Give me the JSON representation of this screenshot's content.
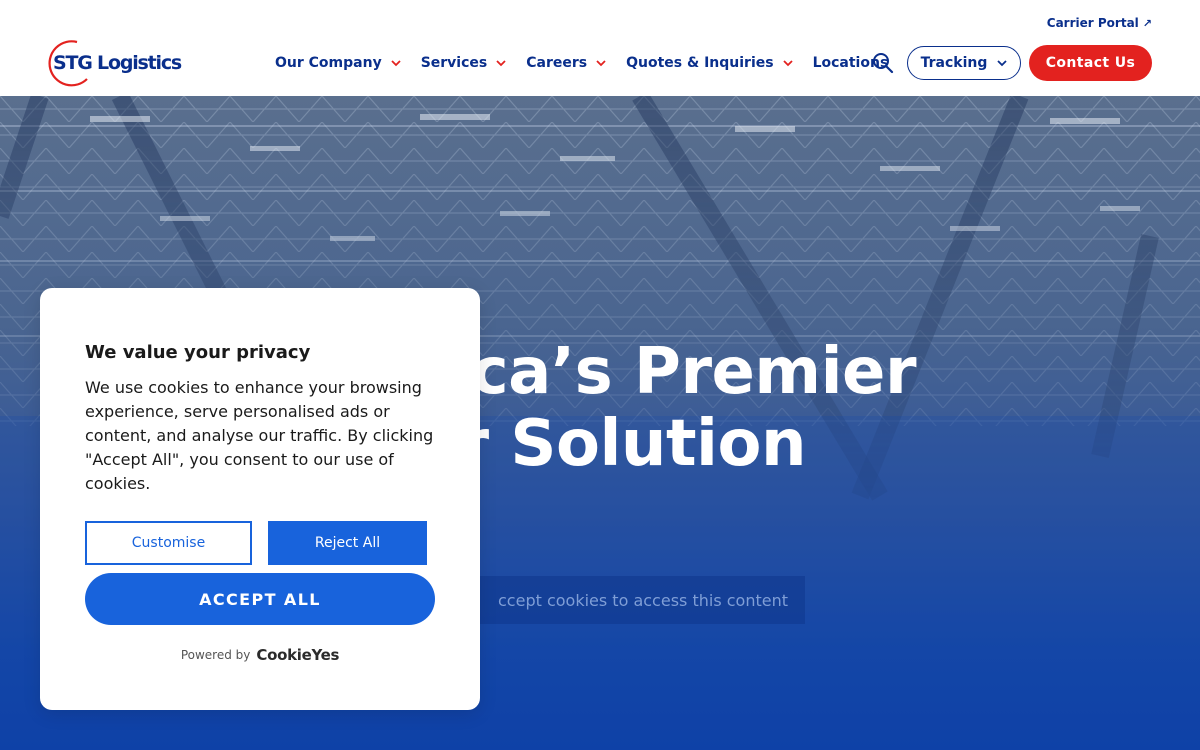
{
  "header": {
    "logo_text": "STG Logistics",
    "carrier_portal_label": "Carrier Portal",
    "carrier_portal_icon": "external-arrow-icon",
    "nav": [
      {
        "label": "Our Company",
        "has_dropdown": true
      },
      {
        "label": "Services",
        "has_dropdown": true
      },
      {
        "label": "Careers",
        "has_dropdown": true
      },
      {
        "label": "Quotes & Inquiries",
        "has_dropdown": true
      },
      {
        "label": "Locations",
        "has_dropdown": false
      }
    ],
    "search_icon": "search-icon",
    "tracking_label": "Tracking",
    "contact_label": "Contact Us"
  },
  "hero": {
    "title_line1": "ca’s Premier",
    "title_line2": "r Solution",
    "cookie_placeholder": "ccept cookies to access this content"
  },
  "cookie_modal": {
    "title": "We value your privacy",
    "body": "We use cookies to enhance your browsing experience, serve personalised ads or content, and analyse our traffic. By clicking \"Accept All\", you consent to our use of cookies.",
    "customise_label": "Customise",
    "reject_label": "Reject All",
    "accept_label": "ACCEPT ALL",
    "powered_by": "Powered by",
    "brand": "CookieYes"
  },
  "colors": {
    "brand_navy": "#0a2f8c",
    "brand_red": "#e3221f",
    "cookie_blue": "#1863dc"
  }
}
